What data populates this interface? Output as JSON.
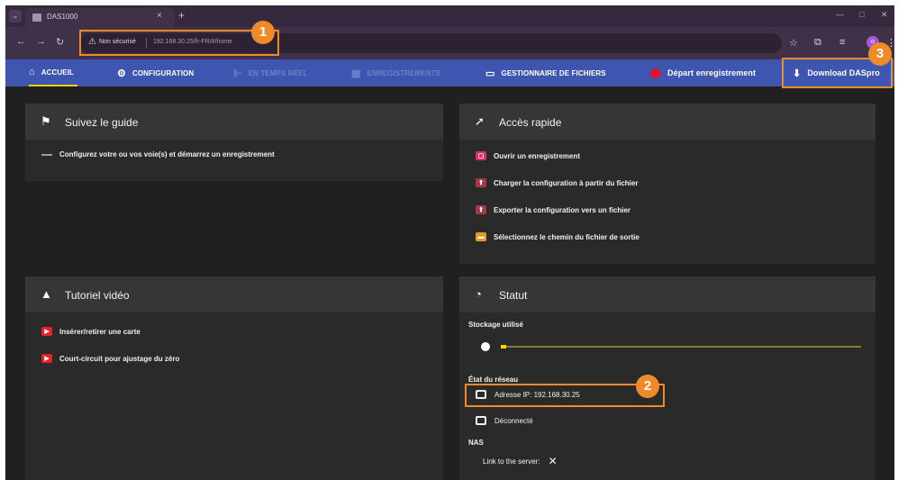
{
  "browser": {
    "tab_title": "DAS1000",
    "tab_close": "×",
    "new_tab": "+",
    "security_warning": "Non sécurisé",
    "url": "192.168.30.25/fr-FR/#/home"
  },
  "nav": {
    "accueil": "ACCUEIL",
    "configuration": "CONFIGURATION",
    "temps_reel": "EN TEMPS RÉEL",
    "enregistrements": "ENREGISTREMENTS",
    "gestionnaire": "GESTIONNAIRE DE FICHIERS",
    "depart": "Départ enregistrement",
    "download": "Download DASpro"
  },
  "guide": {
    "title": "Suivez le guide",
    "items": [
      "Configurez votre ou vos voie(s) et démarrez un enregistrement"
    ]
  },
  "acces": {
    "title": "Accès rapide",
    "items": [
      "Ouvrir un enregistrement",
      "Charger la configuration à partir du fichier",
      "Exporter la configuration vers un fichier",
      "Sélectionnez le chemin du fichier de sortie"
    ]
  },
  "tutoriel": {
    "title": "Tutoriel vidéo",
    "items": [
      "Insérer/retirer une carte",
      "Court-circuit pour ajustage du zéro"
    ]
  },
  "statut": {
    "title": "Statut",
    "stockage_label": "Stockage utilisé",
    "stockage_fraction": 0.0,
    "reseau_label": "État du réseau",
    "ip": "Adresse IP: 192.168.30.25",
    "deconnecte": "Déconnecté",
    "nas_label": "NAS",
    "link_server": "Link to the server:"
  },
  "annotations": {
    "one": "1",
    "two": "2",
    "three": "3"
  },
  "colors": {
    "accent": "#ef8a2a",
    "nav_bg": "#3f56b0",
    "active_underline": "#ffd200",
    "record": "#e8102a"
  }
}
